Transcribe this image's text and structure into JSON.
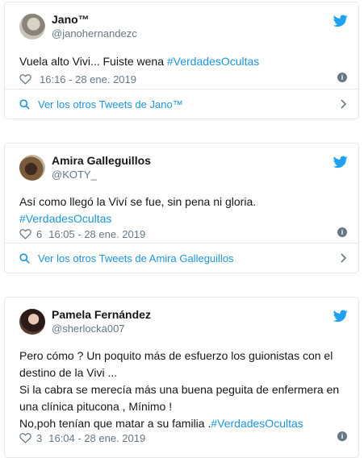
{
  "tweets": [
    {
      "name": "Jano™",
      "handle": "@janohernandezc",
      "text_plain": "Vuela alto Vivi... Fuiste wena ",
      "text_hashtag": "#VerdadesOcultas",
      "likes": "",
      "time": "16:16 - 28 ene. 2019",
      "footer": "Ver los otros Tweets de Jano™"
    },
    {
      "name": "Amira Galleguillos",
      "handle": "@KOTY_",
      "text_line1": "Así como llegó la Viví se fue, sin pena ni gloria.",
      "text_hashtag": "#VerdadesOcultas",
      "likes": "6",
      "time": "16:05 - 28 ene. 2019",
      "footer": "Ver los otros Tweets de Amira Galleguillos"
    },
    {
      "name": "Pamela Fernández",
      "handle": "@sherlocka007",
      "text_line1": "Pero cómo ? Un poquito más de esfuerzo los guionistas con el",
      "text_line2": "destino de la Vivi ...",
      "text_line3": "Si la cabra se merecía más una buena peguita de enfermera en",
      "text_line4": "una clínica pitucona , Mínimo !",
      "text_line5_plain": "No,poh tenían que matar a su familia .",
      "text_hashtag": "#VerdadesOcultas",
      "likes": "3",
      "time": "16:04 - 28 ene. 2019"
    }
  ],
  "icons": {
    "bird": "twitter-bird-icon",
    "heart": "heart-icon",
    "info": "info-icon",
    "search": "search-icon",
    "chevron": "chevron-right-icon"
  },
  "colors": {
    "brand": "#1da1f2",
    "link": "#1b95e0",
    "muted": "#657786",
    "border": "#e1e8ed"
  }
}
